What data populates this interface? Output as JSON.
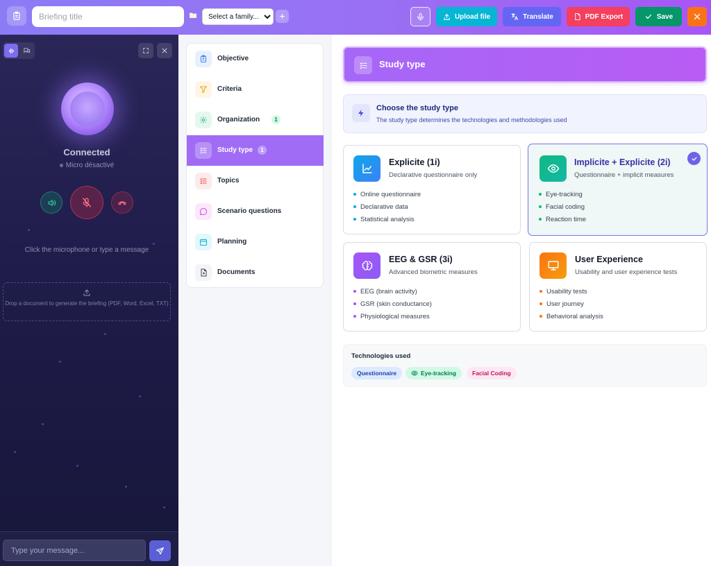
{
  "topbar": {
    "title_placeholder": "Briefing title",
    "family_select": "Select a family...",
    "add_family": "+",
    "upload_label": "Upload file",
    "translate_label": "Translate",
    "pdf_label": "PDF Export",
    "save_label": "Save"
  },
  "voice": {
    "status": "Connected",
    "mic_status": "Micro désactivé",
    "hint": "Click the microphone or type a message",
    "dropzone_text": "Drop a document to generate the briefing (PDF, Word, Excel, TXT)",
    "message_placeholder": "Type your message..."
  },
  "nav": {
    "items": [
      {
        "label": "Objective",
        "badge": "",
        "icon": "clipboard-icon",
        "color": "#3b82f6"
      },
      {
        "label": "Criteria",
        "badge": "",
        "icon": "filter-icon",
        "color": "#f59e0b"
      },
      {
        "label": "Organization",
        "badge": "1",
        "icon": "gear-icon",
        "color": "#10b981"
      },
      {
        "label": "Study type",
        "badge": "1",
        "icon": "list-check-icon",
        "color": "#a855f7"
      },
      {
        "label": "Topics",
        "badge": "",
        "icon": "list-icon",
        "color": "#ef4444"
      },
      {
        "label": "Scenario questions",
        "badge": "",
        "icon": "chat-bubble-icon",
        "color": "#d946ef"
      },
      {
        "label": "Planning",
        "badge": "",
        "icon": "calendar-icon",
        "color": "#06b6d4"
      },
      {
        "label": "Documents",
        "badge": "",
        "icon": "file-plus-icon",
        "color": "#374151"
      }
    ]
  },
  "section": {
    "title": "Study type",
    "info_title": "Choose the study type",
    "info_subtitle": "The study type determines the technologies and methodologies used"
  },
  "study_types": [
    {
      "title": "Explicite (1i)",
      "subtitle": "Declarative questionnaire only",
      "features": [
        "Online questionnaire",
        "Declarative data",
        "Statistical analysis"
      ],
      "icon": "line-chart-icon",
      "color": "#0ea5e9",
      "selected": false
    },
    {
      "title": "Implicite + Explicite (2i)",
      "subtitle": "Questionnaire + implicit measures",
      "features": [
        "Eye-tracking",
        "Facial coding",
        "Reaction time"
      ],
      "icon": "eye-icon",
      "color": "#10b981",
      "selected": true
    },
    {
      "title": "EEG & GSR (3i)",
      "subtitle": "Advanced biometric measures",
      "features": [
        "EEG (brain activity)",
        "GSR (skin conductance)",
        "Physiological measures"
      ],
      "icon": "brain-icon",
      "color": "#a855f7",
      "selected": false
    },
    {
      "title": "User Experience",
      "subtitle": "Usability and user experience tests",
      "features": [
        "Usability tests",
        "User journey",
        "Behavioral analysis"
      ],
      "icon": "monitor-icon",
      "color": "#f97316",
      "selected": false
    }
  ],
  "technologies": {
    "title": "Technologies used",
    "chips": [
      "Questionnaire",
      "Eye-tracking",
      "Facial Coding"
    ]
  },
  "colors": {
    "accent": "#a06cf5",
    "upload": "#06b6d4",
    "translate": "#6366f1",
    "pdf": "#f43f5e",
    "save": "#059669",
    "close": "#f97316"
  }
}
